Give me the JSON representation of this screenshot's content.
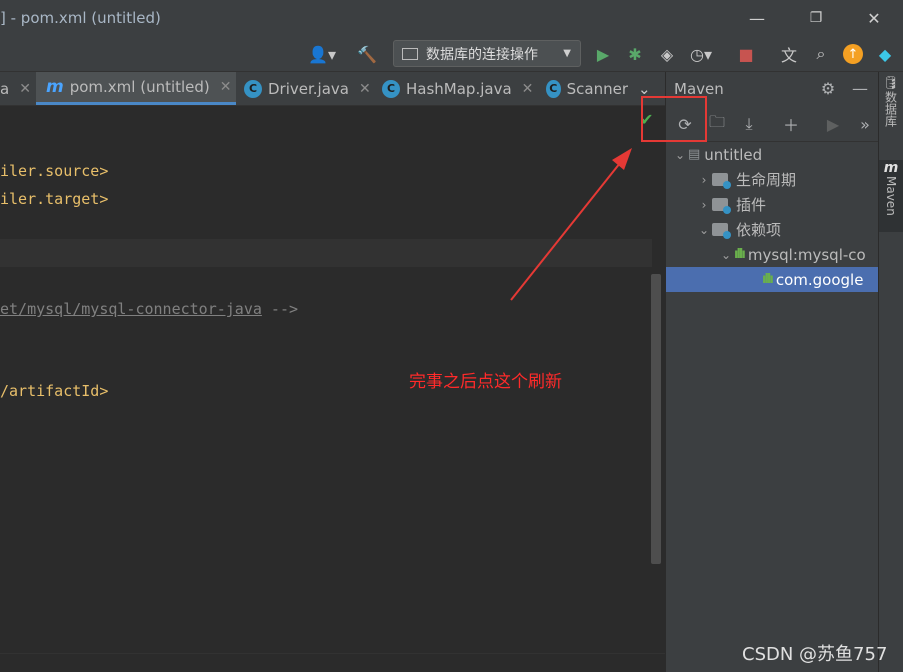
{
  "window": {
    "title": "] - pom.xml (untitled)",
    "minimize": "—",
    "restore": "❐",
    "close": "✕"
  },
  "toolbar": {
    "run_config_label": "数据库的连接操作",
    "icons": [
      "user-icon",
      "build-hammer-icon",
      "run-icon",
      "debug-icon",
      "coverage-icon",
      "profile-icon",
      "stop-icon",
      "translate-icon",
      "search-icon",
      "update-icon",
      "plugin-icon"
    ]
  },
  "tabs": [
    {
      "label": "a",
      "type": "java",
      "active": false
    },
    {
      "label": "pom.xml (untitled)",
      "type": "maven",
      "active": true
    },
    {
      "label": "Driver.java",
      "type": "java",
      "active": false
    },
    {
      "label": "HashMap.java",
      "type": "java",
      "active": false
    },
    {
      "label": "Scanner",
      "type": "java",
      "active": false
    }
  ],
  "editor": {
    "lines": [
      {
        "text": "iler.source>"
      },
      {
        "text": "iler.target>"
      },
      {
        "text": "et/mysql/mysql-connector-java",
        "suffix": " -->"
      },
      {
        "text": "/artifactId>"
      }
    ]
  },
  "maven": {
    "title": "Maven",
    "tree": [
      {
        "label": "untitled",
        "expanded": true
      },
      {
        "label": "生命周期",
        "expanded": false
      },
      {
        "label": "插件",
        "expanded": false
      },
      {
        "label": "依赖项",
        "expanded": true
      },
      {
        "label": "mysql:mysql-co",
        "expanded": true
      },
      {
        "label": "com.google",
        "selected": true
      }
    ]
  },
  "stripe": {
    "database": "数据库",
    "maven": "Maven"
  },
  "annotation": {
    "text": "完事之后点这个刷新",
    "color": "#ff2a2a"
  },
  "watermark": "CSDN @苏鱼757"
}
